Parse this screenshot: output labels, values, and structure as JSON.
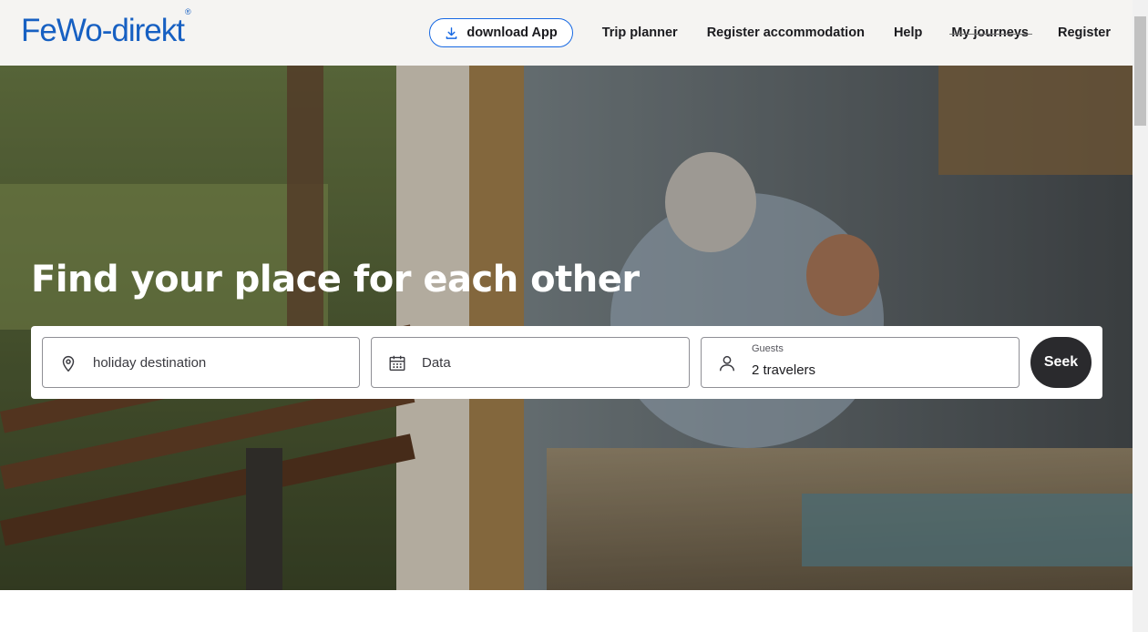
{
  "brand": {
    "logo_text": "FeWo-direkt",
    "logo_mark": "®",
    "brand_color": "#1760c2"
  },
  "nav": {
    "download_label": "download App",
    "items": [
      {
        "label": "Trip planner"
      },
      {
        "label": "Register accommodation"
      },
      {
        "label": "Help"
      },
      {
        "label": "My journeys"
      },
      {
        "label": "Register"
      }
    ]
  },
  "hero": {
    "title": "Find your place for each other"
  },
  "search": {
    "destination": {
      "value": "holiday destination",
      "icon": "map-pin-icon"
    },
    "dates": {
      "value": "Data",
      "icon": "calendar-icon"
    },
    "guests": {
      "label": "Guests",
      "value": "2 travelers",
      "icon": "person-icon"
    },
    "submit_label": "Seek"
  },
  "colors": {
    "accent": "#1668e3",
    "button_dark": "#2a2a2d"
  }
}
